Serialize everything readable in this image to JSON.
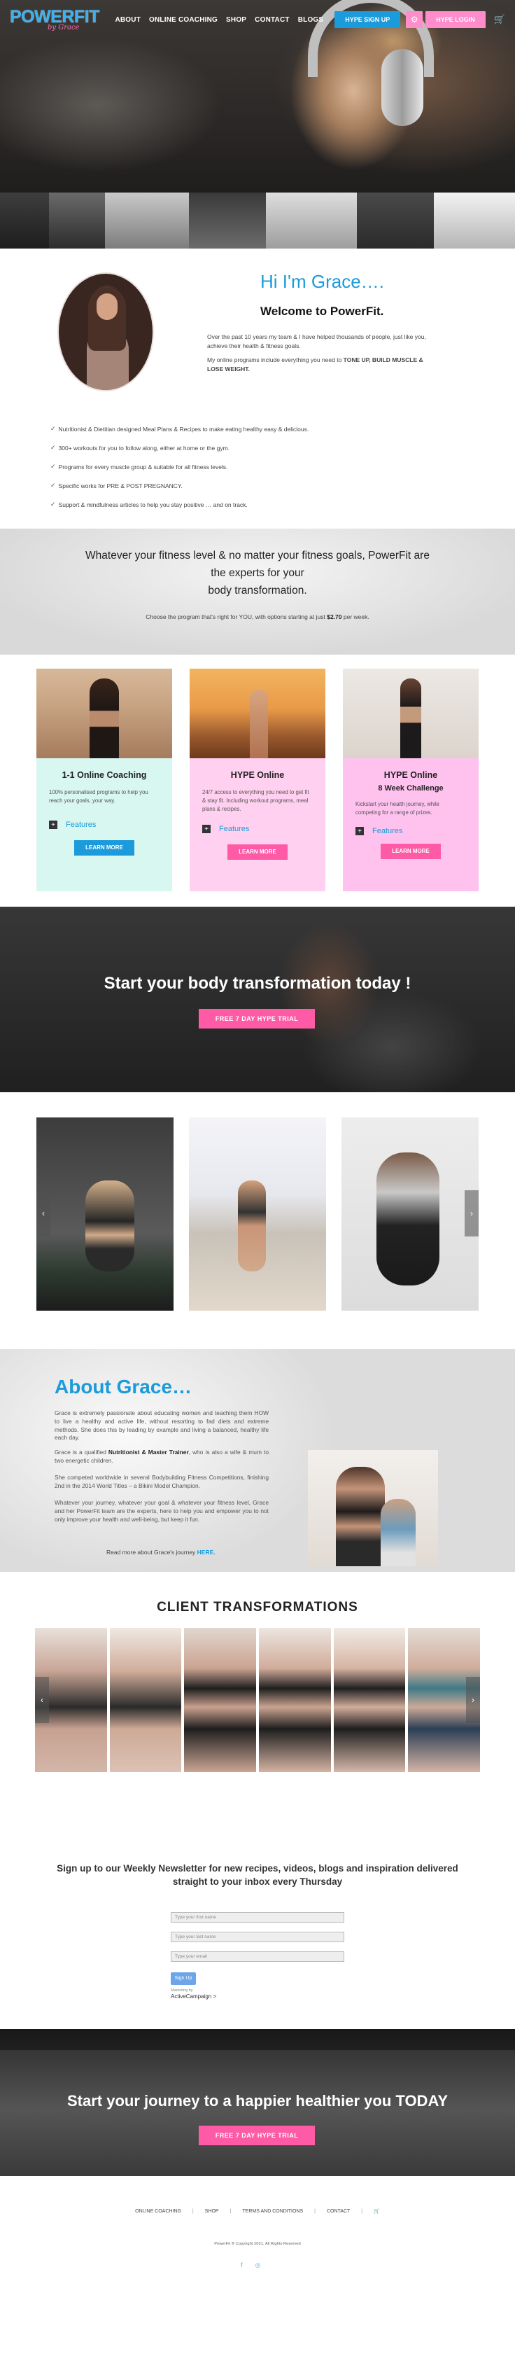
{
  "nav": {
    "logo_main": "POWERFIT",
    "logo_sub": "by Grace",
    "links": [
      "ABOUT",
      "ONLINE COACHING",
      "SHOP",
      "CONTACT",
      "BLOGS"
    ],
    "signup": "HYPE SIGN UP",
    "login": "HYPE LOGIN"
  },
  "intro": {
    "title": "Hi I'm Grace….",
    "subtitle": "Welcome to PowerFit.",
    "para1": "Over the past 10 years my team & I have helped thousands of people, just like you, achieve their health & fitness goals.",
    "para2_prefix": "My online programs include everything you need to ",
    "para2_bold": "TONE UP, BUILD MUSCLE & LOSE WEIGHT.",
    "checklist": [
      "Nutritionist & Dietitian designed Meal Plans & Recipes to make eating healthy easy & delicious.",
      "300+ workouts for you to follow along, either at home or the gym.",
      "Programs for every muscle group & suitable for all fitness levels.",
      "Specific works for PRE & POST PREGNANCY.",
      "Support & mindfulness articles to help you stay positive … and on track."
    ]
  },
  "banner": {
    "line1": "Whatever your fitness level & no matter your fitness goals, PowerFit are",
    "line2": "the experts for your",
    "line3": "body transformation.",
    "small_prefix": "Choose the program that's right for YOU, with options starting at just ",
    "small_bold": "$2.70",
    "small_suffix": " per week."
  },
  "programs": [
    {
      "title": "1-1 Online Coaching",
      "subtitle": "",
      "desc": "100% personalised programs to help you reach your goals, your way.",
      "features": "Features",
      "button": "LEARN MORE"
    },
    {
      "title": "HYPE Online",
      "subtitle": "",
      "desc": "24/7 access to everything you need to get fit & stay fit. Including workout programs, meal plans & recipes.",
      "features": "Features",
      "button": "LEARN MORE"
    },
    {
      "title": "HYPE Online",
      "subtitle": "8 Week Challenge",
      "desc": "Kickstart your health journey, while competing for a range of prizes.",
      "features": "Features",
      "button": "LEARN MORE"
    }
  ],
  "cta1": {
    "heading": "Start your body transformation today !",
    "button": "FREE 7 DAY HYPE TRIAL"
  },
  "about": {
    "heading": "About Grace…",
    "p1": "Grace is extremely passionate about educating women and teaching them HOW to live a healthy and active life, without resorting to fad diets and extreme methods. She does this by leading by example and living a balanced, healthy life each day.",
    "p2_prefix": "Grace is a qualified ",
    "p2_bold": "Nutritionist & Master Trainer",
    "p2_suffix": ", who is also a wife & mum to two energetic children.",
    "p3": "She competed worldwide in several Bodybuilding Fitness Competitions, finishing 2nd in the 2014 World Titles – a Bikini Model Champion.",
    "p4": "Whatever your journey, whatever your goal & whatever your fitness level, Grace and her PowerFit team are the experts, here to help you and empower you to not only improve your health and well-being, but keep it fun.",
    "more_prefix": "Read more about Grace's journey ",
    "more_link": "HERE."
  },
  "transformations": {
    "heading": "CLIENT TRANSFORMATIONS"
  },
  "newsletter": {
    "heading1": "Sign up to our Weekly Newsletter for new recipes, videos, blogs and inspiration delivered",
    "heading2": "straight to your inbox every Thursday",
    "first_name": "Type your first name",
    "last_name": "Type your last name",
    "email": "Type your email",
    "button": "Sign Up",
    "powered_by": "Marketing by",
    "active_campaign": "ActiveCampaign >"
  },
  "cta2": {
    "heading": "Start your journey to a happier healthier you TODAY",
    "button": "FREE 7 DAY HYPE TRIAL"
  },
  "footer": {
    "links": [
      "ONLINE COACHING",
      "SHOP",
      "TERMS AND CONDITIONS",
      "CONTACT"
    ],
    "copyright": "PowerFit ® Copyright 2021. All Rights Reserved"
  },
  "colors": {
    "brand_blue": "#1b9bdb",
    "brand_pink": "#ff8ccb",
    "cta_pink": "#ff5aa5",
    "coaching_card": "#d8f7f0",
    "hype_card": "#ffd0ef",
    "challenge_card": "#ffc2ee"
  }
}
